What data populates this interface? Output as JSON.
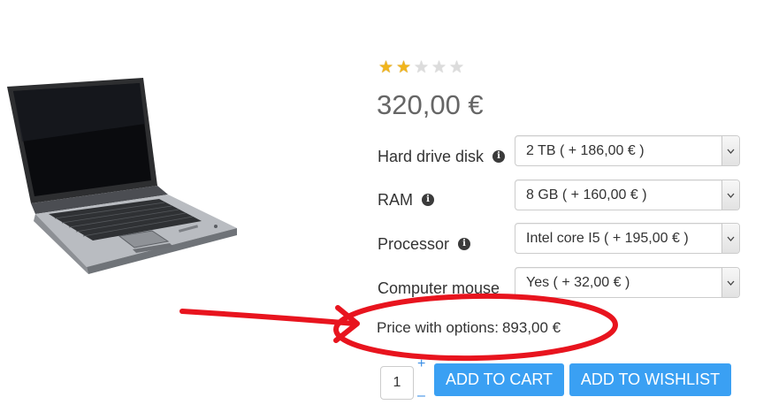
{
  "product": {
    "rating": {
      "value": 2,
      "max": 5
    },
    "price": "320,00 €"
  },
  "options": [
    {
      "label": "Hard drive disk",
      "has_info": true,
      "selected": "2 TB ( + 186,00 € )"
    },
    {
      "label": "RAM",
      "has_info": true,
      "selected": "8 GB ( + 160,00 € )"
    },
    {
      "label": "Processor",
      "has_info": true,
      "selected": "Intel core I5 ( + 195,00 € )"
    },
    {
      "label": "Computer mouse",
      "has_info": false,
      "selected": "Yes ( + 32,00 € )"
    }
  ],
  "price_with_options": {
    "label": "Price with options:",
    "value": "893,00 €"
  },
  "quantity": {
    "value": "1",
    "plus": "+",
    "minus": "–"
  },
  "buttons": {
    "add_to_cart": "ADD TO CART",
    "add_to_wishlist": "ADD TO WISHLIST"
  },
  "colors": {
    "accent": "#3aa0f3",
    "annotation": "#e8141e",
    "star_on": "#f1b51c",
    "star_off": "#dcdcdc"
  },
  "icons": {
    "info": "info-icon",
    "select_arrow": "chevron-down-icon",
    "star": "star-icon"
  }
}
